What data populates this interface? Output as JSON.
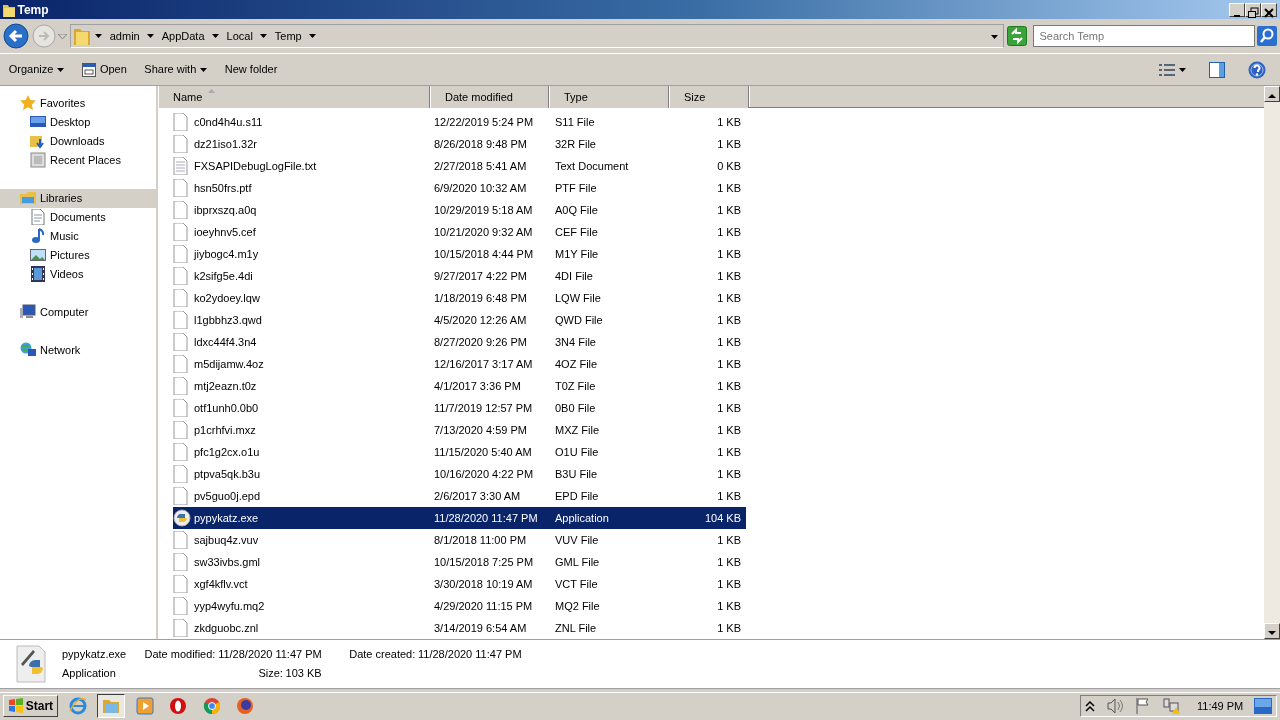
{
  "window": {
    "title": "Temp"
  },
  "address": {
    "crumbs": [
      "admin",
      "AppData",
      "Local",
      "Temp"
    ]
  },
  "search": {
    "placeholder": "Search Temp"
  },
  "toolbar": {
    "buttons": [
      {
        "label": "Organize",
        "kind": "menu"
      },
      {
        "label": "Open",
        "kind": "icon"
      },
      {
        "label": "Share with",
        "kind": "menu"
      },
      {
        "label": "New folder",
        "kind": "plain"
      }
    ]
  },
  "sidebar": {
    "groups": [
      {
        "label": "Favorites",
        "selected": false,
        "children": [
          {
            "label": "Desktop",
            "selected": false
          },
          {
            "label": "Downloads",
            "selected": false
          },
          {
            "label": "Recent Places",
            "selected": false
          }
        ]
      },
      {
        "label": "Libraries",
        "selected": true,
        "children": [
          {
            "label": "Documents",
            "selected": false
          },
          {
            "label": "Music",
            "selected": false
          },
          {
            "label": "Pictures",
            "selected": false
          },
          {
            "label": "Videos",
            "selected": false
          }
        ]
      },
      {
        "label": "Computer",
        "selected": false
      },
      {
        "label": "Network",
        "selected": false
      }
    ]
  },
  "table": {
    "columns": [
      {
        "label": "Name",
        "sorted": true
      },
      {
        "label": "Date modified",
        "sorted": false
      },
      {
        "label": "Type",
        "sorted": false
      },
      {
        "label": "Size",
        "sorted": false
      }
    ],
    "rows": [
      {
        "kind": "file",
        "selected": false,
        "cells": [
          "c0nd4h4u.s11",
          "12/22/2019 5:24 PM",
          "S11 File",
          "1 KB"
        ]
      },
      {
        "kind": "file",
        "selected": false,
        "cells": [
          "dz21iso1.32r",
          "8/26/2018 9:48 PM",
          "32R File",
          "1 KB"
        ]
      },
      {
        "kind": "text",
        "selected": false,
        "cells": [
          "FXSAPIDebugLogFile.txt",
          "2/27/2018 5:41 AM",
          "Text Document",
          "0 KB"
        ]
      },
      {
        "kind": "file",
        "selected": false,
        "cells": [
          "hsn50frs.ptf",
          "6/9/2020 10:32 AM",
          "PTF File",
          "1 KB"
        ]
      },
      {
        "kind": "file",
        "selected": false,
        "cells": [
          "ibprxszq.a0q",
          "10/29/2019 5:18 AM",
          "A0Q File",
          "1 KB"
        ]
      },
      {
        "kind": "file",
        "selected": false,
        "cells": [
          "ioeyhnv5.cef",
          "10/21/2020 9:32 AM",
          "CEF File",
          "1 KB"
        ]
      },
      {
        "kind": "file",
        "selected": false,
        "cells": [
          "jiybogc4.m1y",
          "10/15/2018 4:44 PM",
          "M1Y File",
          "1 KB"
        ]
      },
      {
        "kind": "file",
        "selected": false,
        "cells": [
          "k2sifg5e.4di",
          "9/27/2017 4:22 PM",
          "4DI File",
          "1 KB"
        ]
      },
      {
        "kind": "file",
        "selected": false,
        "cells": [
          "ko2ydoey.lqw",
          "1/18/2019 6:48 PM",
          "LQW File",
          "1 KB"
        ]
      },
      {
        "kind": "file",
        "selected": false,
        "cells": [
          "l1gbbhz3.qwd",
          "4/5/2020 12:26 AM",
          "QWD File",
          "1 KB"
        ]
      },
      {
        "kind": "file",
        "selected": false,
        "cells": [
          "ldxc44f4.3n4",
          "8/27/2020 9:26 PM",
          "3N4 File",
          "1 KB"
        ]
      },
      {
        "kind": "file",
        "selected": false,
        "cells": [
          "m5dijamw.4oz",
          "12/16/2017 3:17 AM",
          "4OZ File",
          "1 KB"
        ]
      },
      {
        "kind": "file",
        "selected": false,
        "cells": [
          "mtj2eazn.t0z",
          "4/1/2017 3:36 PM",
          "T0Z File",
          "1 KB"
        ]
      },
      {
        "kind": "file",
        "selected": false,
        "cells": [
          "otf1unh0.0b0",
          "11/7/2019 12:57 PM",
          "0B0 File",
          "1 KB"
        ]
      },
      {
        "kind": "file",
        "selected": false,
        "cells": [
          "p1crhfvi.mxz",
          "7/13/2020 4:59 PM",
          "MXZ File",
          "1 KB"
        ]
      },
      {
        "kind": "file",
        "selected": false,
        "cells": [
          "pfc1g2cx.o1u",
          "11/15/2020 5:40 AM",
          "O1U File",
          "1 KB"
        ]
      },
      {
        "kind": "file",
        "selected": false,
        "cells": [
          "ptpva5qk.b3u",
          "10/16/2020 4:22 PM",
          "B3U File",
          "1 KB"
        ]
      },
      {
        "kind": "file",
        "selected": false,
        "cells": [
          "pv5guo0j.epd",
          "2/6/2017 3:30 AM",
          "EPD File",
          "1 KB"
        ]
      },
      {
        "kind": "app",
        "selected": true,
        "cells": [
          "pypykatz.exe",
          "11/28/2020 11:47 PM",
          "Application",
          "104 KB"
        ]
      },
      {
        "kind": "file",
        "selected": false,
        "cells": [
          "sajbuq4z.vuv",
          "8/1/2018 11:00 PM",
          "VUV File",
          "1 KB"
        ]
      },
      {
        "kind": "file",
        "selected": false,
        "cells": [
          "sw33ivbs.gml",
          "10/15/2018 7:25 PM",
          "GML File",
          "1 KB"
        ]
      },
      {
        "kind": "file",
        "selected": false,
        "cells": [
          "xgf4kflv.vct",
          "3/30/2018 10:19 AM",
          "VCT File",
          "1 KB"
        ]
      },
      {
        "kind": "file",
        "selected": false,
        "cells": [
          "yyp4wyfu.mq2",
          "4/29/2020 11:15 PM",
          "MQ2 File",
          "1 KB"
        ]
      },
      {
        "kind": "file",
        "selected": false,
        "cells": [
          "zkdguobc.znl",
          "3/14/2019 6:54 AM",
          "ZNL File",
          "1 KB"
        ]
      }
    ]
  },
  "details": {
    "name": "pypykatz.exe",
    "type": "Application",
    "fields": [
      {
        "label": "Date modified:",
        "value": "11/28/2020 11:47 PM"
      },
      {
        "label": "Size:",
        "value": "103 KB"
      },
      {
        "label": "Date created:",
        "value": "11/28/2020 11:47 PM"
      }
    ]
  },
  "taskbar": {
    "start": "Start",
    "apps": [
      {
        "selected": false
      },
      {
        "selected": true
      },
      {
        "selected": false
      },
      {
        "selected": false
      },
      {
        "selected": false
      },
      {
        "selected": false
      }
    ],
    "clock": "11:49 PM"
  }
}
